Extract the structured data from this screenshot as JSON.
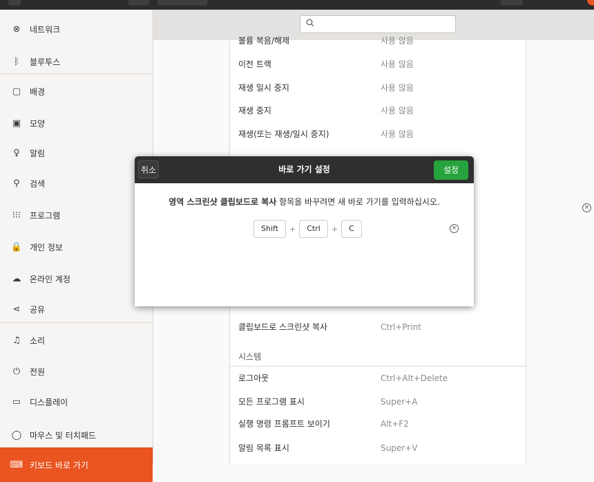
{
  "sidebar": {
    "items": [
      {
        "label": "네트워크",
        "icon": "network-icon",
        "glyph": "⊗"
      },
      {
        "label": "블루투스",
        "icon": "bluetooth-icon",
        "glyph": "ᛒ"
      },
      {
        "label": "배경",
        "icon": "background-icon",
        "glyph": "▢"
      },
      {
        "label": "모양",
        "icon": "appearance-icon",
        "glyph": "▣"
      },
      {
        "label": "알림",
        "icon": "bell-icon",
        "glyph": "♀"
      },
      {
        "label": "검색",
        "icon": "search-icon",
        "glyph": "⚲"
      },
      {
        "label": "프로그램",
        "icon": "apps-grid-icon",
        "glyph": "⁝⁝⁝"
      },
      {
        "label": "개인 정보",
        "icon": "lock-icon",
        "glyph": "🔒"
      },
      {
        "label": "온라인 계정",
        "icon": "cloud-icon",
        "glyph": "☁"
      },
      {
        "label": "공유",
        "icon": "share-icon",
        "glyph": "⋖"
      },
      {
        "label": "소리",
        "icon": "music-note-icon",
        "glyph": "♫"
      },
      {
        "label": "전원",
        "icon": "power-icon",
        "glyph": "⏻"
      },
      {
        "label": "디스플레이",
        "icon": "display-icon",
        "glyph": "▭"
      },
      {
        "label": "마우스 및 터치패드",
        "icon": "mouse-icon",
        "glyph": "◯"
      },
      {
        "label": "키보드 바로 가기",
        "icon": "keyboard-icon",
        "glyph": "⌨"
      }
    ]
  },
  "shortcuts": {
    "rows_top": [
      {
        "name": "볼륨 복음/해제",
        "value": "사용 않음"
      },
      {
        "name": "이전 트랙",
        "value": "사용 않음"
      },
      {
        "name": "재생 일시 중지",
        "value": "사용 않음"
      },
      {
        "name": "재생 중지",
        "value": "사용 않음"
      },
      {
        "name": "재생(또는 재생/일시 중지)",
        "value": "사용 않음"
      }
    ],
    "row_screenshot": {
      "name": "클립보드로 스크린샷 복사",
      "value": "Ctrl+Print"
    },
    "section_system": "시스템",
    "rows_system": [
      {
        "name": "로그아웃",
        "value": "Ctrl+Alt+Delete"
      },
      {
        "name": "모든 프로그램 표시",
        "value": "Super+A"
      },
      {
        "name": "실행 명령 프롬프트 보이기",
        "value": "Alt+F2"
      },
      {
        "name": "알림 목록 표시",
        "value": "Super+V"
      }
    ]
  },
  "dialog": {
    "cancel_label": "취소",
    "title": "바로 가기 설정",
    "set_label": "설정",
    "message_bold": "영역 스크린샷 클립보드로 복사",
    "message_rest": " 항목을 바꾸려면 새 바로 가기를 입력하십시오.",
    "keys": [
      "Shift",
      "Ctrl",
      "C"
    ],
    "plus": "+"
  },
  "colors": {
    "accent": "#e95420",
    "set_button": "#26a33c",
    "header_bar": "#2f2f2f"
  }
}
